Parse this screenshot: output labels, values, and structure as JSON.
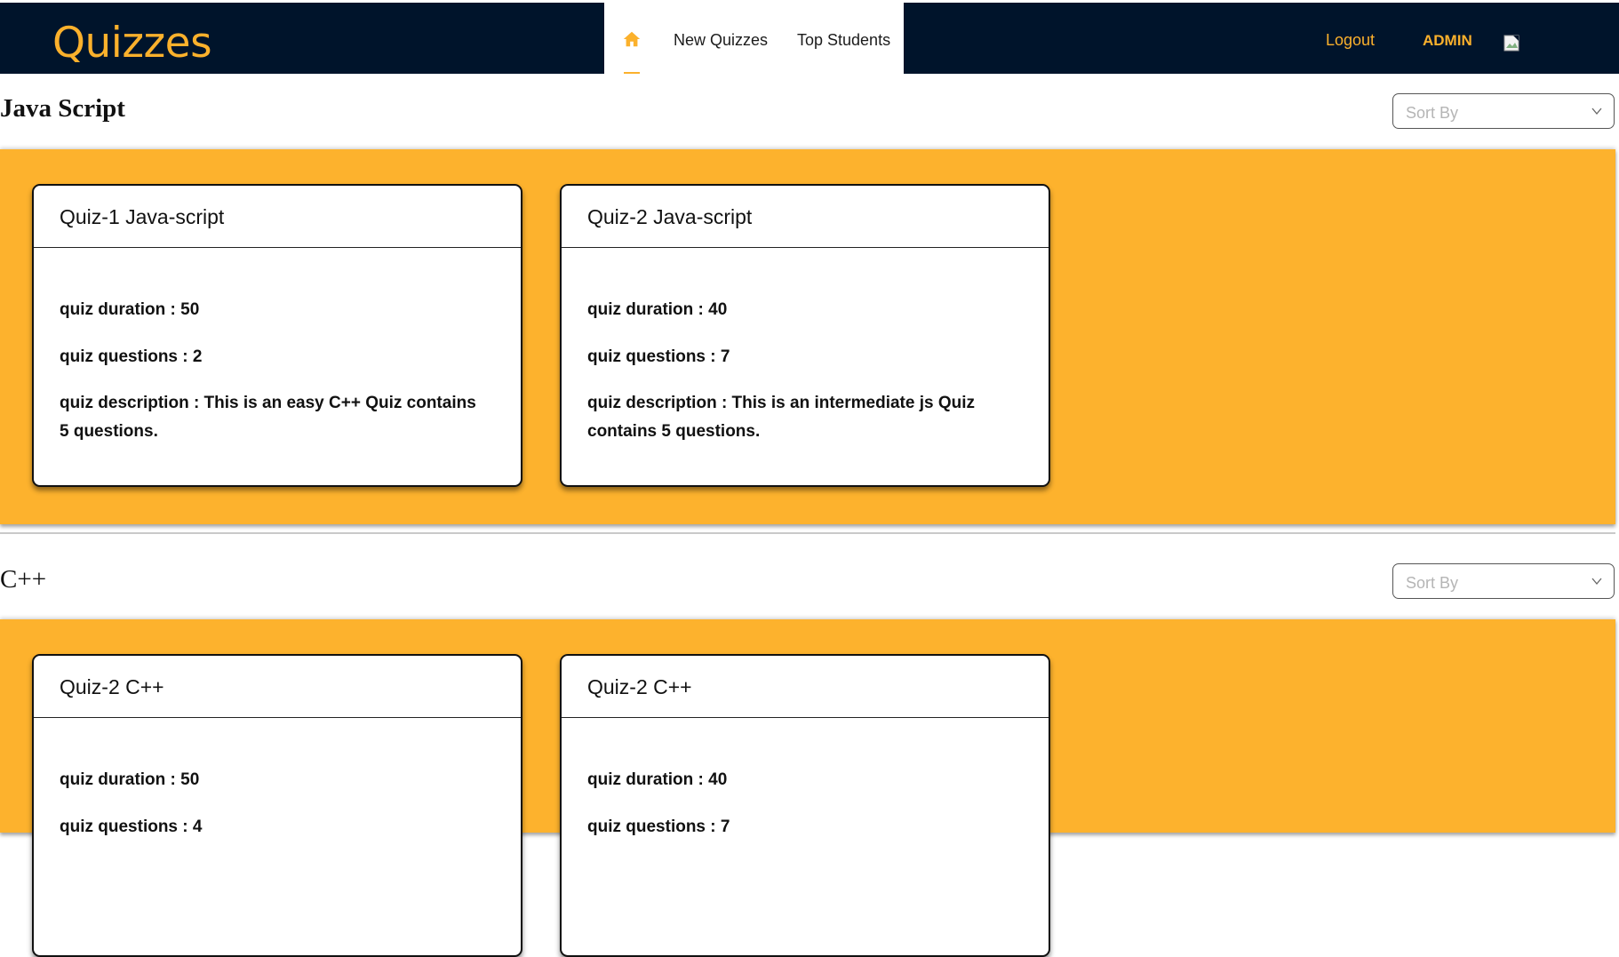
{
  "header": {
    "brand": "Quizzes",
    "nav": {
      "home_icon": "home-icon",
      "new_quizzes": "New Quizzes",
      "top_students": "Top Students"
    },
    "logout": "Logout",
    "user": "ADMIN",
    "avatar_icon": "broken-image-icon",
    "accent_color": "#fbb12c",
    "bg_color": "#00142b"
  },
  "sections": [
    {
      "title": "Java Script",
      "sort_placeholder": "Sort By",
      "cards": [
        {
          "title": "Quiz-1 Java-script",
          "duration": "quiz duration : 50",
          "questions": "quiz questions : 2",
          "description": "quiz description : This is an easy C++ Quiz contains 5 questions."
        },
        {
          "title": "Quiz-2 Java-script",
          "duration": "quiz duration : 40",
          "questions": "quiz questions : 7",
          "description": "quiz description : This is an intermediate js Quiz contains 5 questions."
        }
      ]
    },
    {
      "title": "C++",
      "sort_placeholder": "Sort By",
      "cards": [
        {
          "title": "Quiz-2 C++",
          "duration": "quiz duration : 50",
          "questions": "quiz questions : 4"
        },
        {
          "title": "Quiz-2 C++",
          "duration": "quiz duration : 40",
          "questions": "quiz questions : 7"
        }
      ]
    }
  ],
  "band_color": "#fdb22d"
}
